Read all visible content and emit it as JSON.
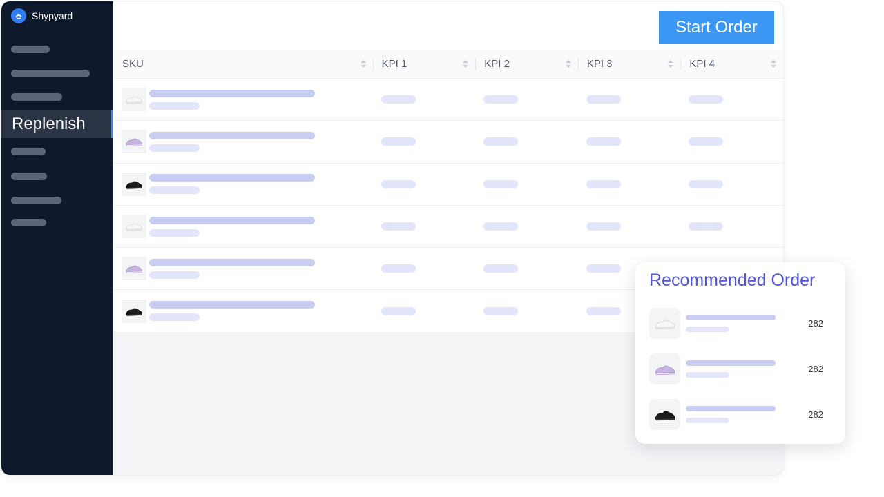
{
  "app": {
    "name": "Shypyard"
  },
  "sidebar": {
    "active_item": "Replenish"
  },
  "toolbar": {
    "start_order_label": "Start Order"
  },
  "table": {
    "columns": [
      "SKU",
      "KPI 1",
      "KPI 2",
      "KPI 3",
      "KPI 4"
    ],
    "rows": [
      {
        "shoe": "white-sneaker-icon"
      },
      {
        "shoe": "lilac-sneaker-icon"
      },
      {
        "shoe": "black-sneaker-icon"
      },
      {
        "shoe": "white-sneaker-icon"
      },
      {
        "shoe": "lilac-sneaker-icon"
      },
      {
        "shoe": "black-sneaker-icon"
      }
    ]
  },
  "recommended": {
    "title": "Recommended Order",
    "items": [
      {
        "shoe": "white-sneaker-icon",
        "qty": "282"
      },
      {
        "shoe": "lilac-sneaker-icon",
        "qty": "282"
      },
      {
        "shoe": "black-sneaker-icon",
        "qty": "282"
      }
    ]
  },
  "colors": {
    "sidebar_bg": "#0e1a2b",
    "accent": "#3b97f3",
    "title_accent": "#5157d6",
    "skeleton": "#c9cdf2"
  }
}
